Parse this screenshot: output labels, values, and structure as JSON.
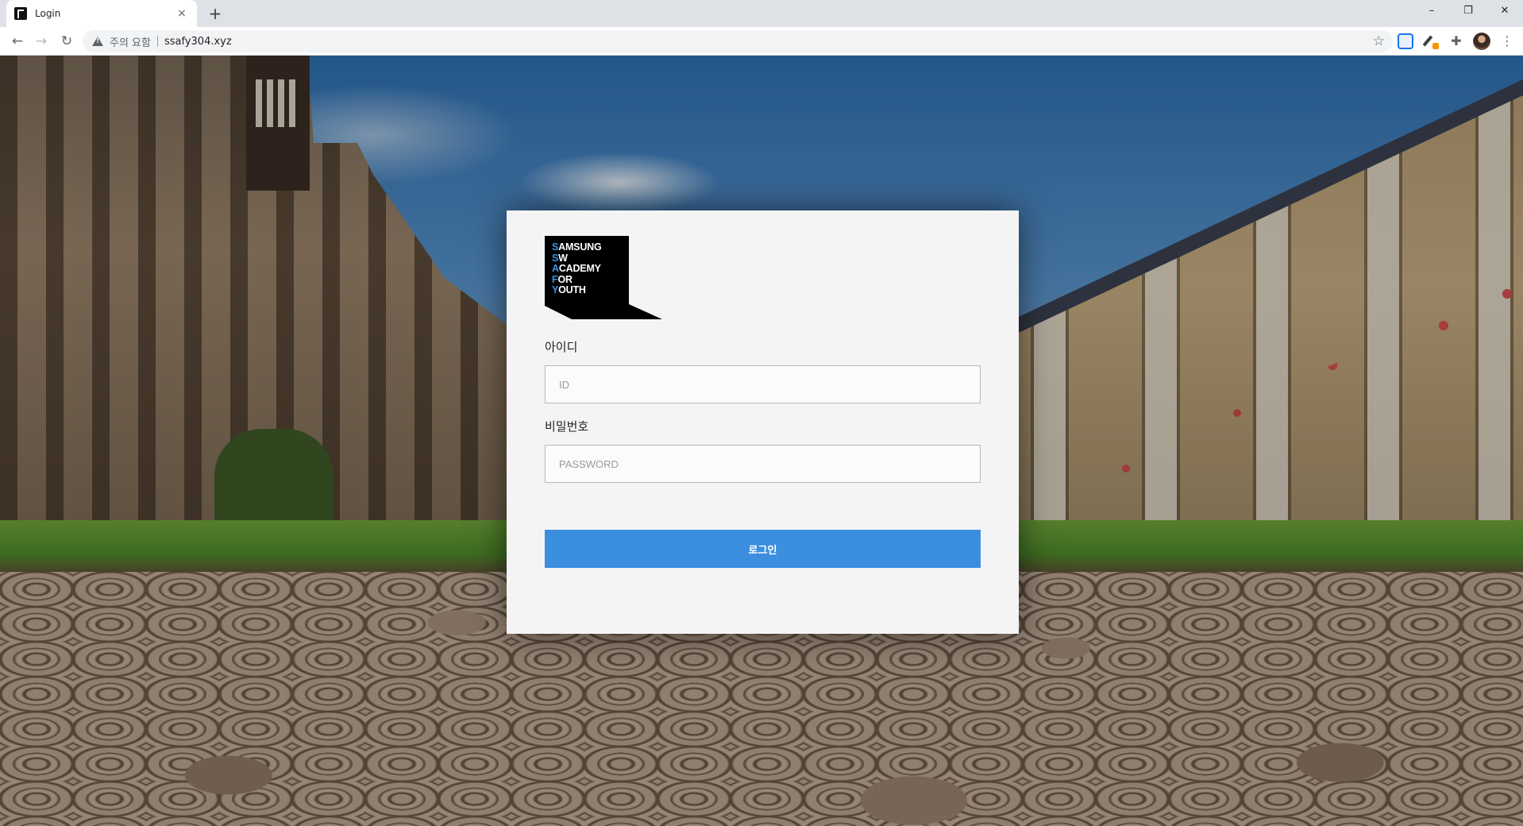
{
  "browser": {
    "tab_title": "Login",
    "tab_close": "×",
    "new_tab": "+",
    "window_controls": {
      "minimize": "–",
      "restore": "❐",
      "close": "✕"
    },
    "nav": {
      "back": "←",
      "forward": "→",
      "reload": "↻"
    },
    "security_warning": "주의 요함",
    "url": "ssafy304.xyz",
    "bookmark_star": "☆",
    "puzzle_glyph": "✚",
    "menu_glyph": "⋮"
  },
  "login": {
    "logo_lines": [
      {
        "initial": "S",
        "rest": "AMSUNG"
      },
      {
        "initial": "S",
        "rest": "W"
      },
      {
        "initial": "A",
        "rest": "CADEMY"
      },
      {
        "initial": "F",
        "rest": "OR"
      },
      {
        "initial": "Y",
        "rest": "OUTH"
      }
    ],
    "id_label": "아이디",
    "id_placeholder": "ID",
    "id_value": "",
    "password_label": "비밀번호",
    "password_placeholder": "PASSWORD",
    "password_value": "",
    "submit_label": "로그인"
  },
  "colors": {
    "accent": "#3c8fe0",
    "logo_initial": "#3d95e6",
    "card_background": "#f4f4f4"
  }
}
